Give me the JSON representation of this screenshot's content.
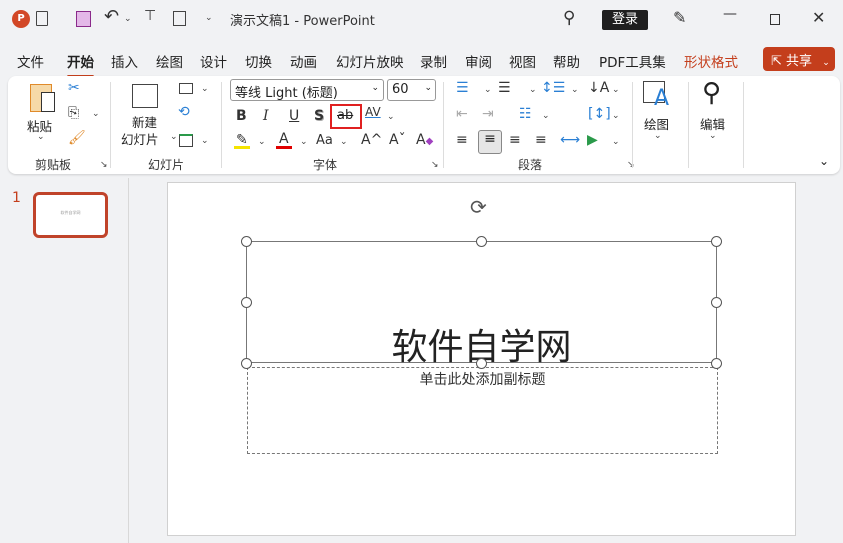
{
  "titlebar": {
    "doc_title": "演示文稿1",
    "sep": "-",
    "app_name": "PowerPoint",
    "login": "登录"
  },
  "menu": {
    "items": [
      "文件",
      "开始",
      "插入",
      "绘图",
      "设计",
      "切换",
      "动画",
      "幻灯片放映",
      "录制",
      "审阅",
      "视图",
      "帮助",
      "PDF工具集",
      "形状格式"
    ],
    "share": "共享"
  },
  "ribbon": {
    "clipboard": {
      "paste": "粘贴",
      "label": "剪贴板"
    },
    "slides": {
      "new_slide_1": "新建",
      "new_slide_2": "幻灯片",
      "label": "幻灯片"
    },
    "font": {
      "font_name": "等线 Light (标题)",
      "font_size": "60",
      "bold": "B",
      "italic": "I",
      "underline": "U",
      "shadow": "S",
      "strike": "ab",
      "spacing": "AV",
      "font_color": "A",
      "change_case": "Aa",
      "grow": "A^",
      "shrink": "Aˇ",
      "clear": "A",
      "label": "字体",
      "highlight_color": "#f5e400",
      "font_color_hex": "#e00000"
    },
    "paragraph": {
      "label": "段落"
    },
    "drawing": {
      "label": "绘图"
    },
    "editing": {
      "label": "编辑"
    }
  },
  "thumbs": {
    "number": "1",
    "thumb_text": "软件自学网"
  },
  "slide": {
    "title": "软件自学网",
    "subtitle": "单击此处添加副标题"
  },
  "colors": {
    "accent": "#c43e1c"
  }
}
